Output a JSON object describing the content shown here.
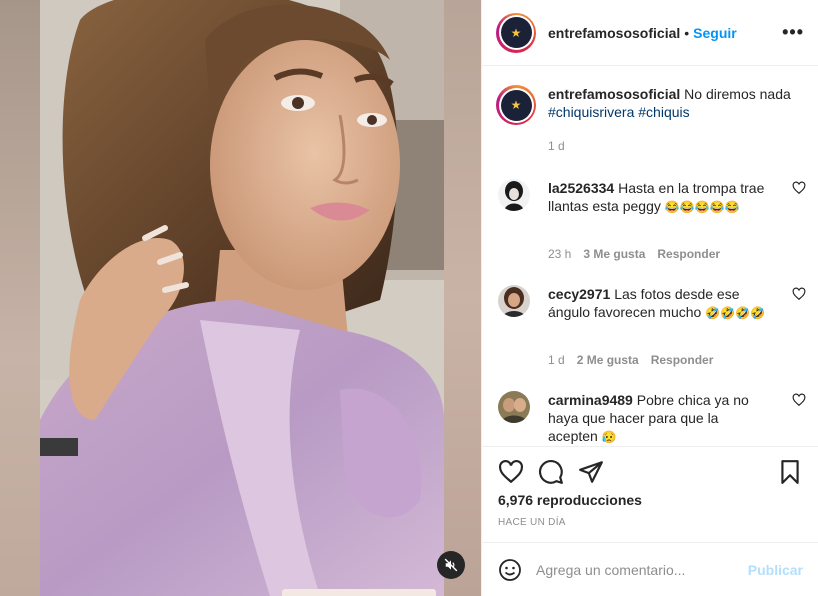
{
  "post": {
    "username": "entrefamososoficial",
    "dot": "•",
    "follow_label": "Seguir",
    "more_label": "•••"
  },
  "caption": {
    "username": "entrefamososoficial",
    "text": "No diremos nada",
    "tags": [
      "#chiquisrivera",
      "#chiquis"
    ],
    "age": "1 d"
  },
  "comments": [
    {
      "username": "la2526334",
      "text": "Hasta en la trompa trae llantas esta peggy",
      "emojis": "😂😂😂😂😂",
      "age": "23 h",
      "likes": "3 Me gusta",
      "reply_label": "Responder"
    },
    {
      "username": "cecy2971",
      "text": "Las fotos desde ese ángulo favorecen mucho",
      "emojis": "🤣🤣🤣🤣",
      "age": "1 d",
      "likes": "2 Me gusta",
      "reply_label": "Responder"
    },
    {
      "username": "carmina9489",
      "text": "Pobre chica ya no haya que hacer para que la acepten",
      "emojis": "😥",
      "age": "",
      "likes": "",
      "reply_label": ""
    }
  ],
  "stats": {
    "views": "6,976 reproducciones",
    "posted": "HACE UN DÍA"
  },
  "add_comment": {
    "placeholder": "Agrega un comentario...",
    "publish_label": "Publicar"
  },
  "icons": {
    "like": "heart-icon",
    "comment": "comment-icon",
    "share": "paper-plane-icon",
    "save": "bookmark-icon",
    "emoji": "smiley-icon",
    "mute": "speaker-muted-icon",
    "more": "more-dots-icon"
  },
  "colors": {
    "link_blue": "#0095f6",
    "hashtag": "#00376b",
    "muted_text": "#8e8e8e",
    "publish_disabled": "#b2dffc"
  }
}
